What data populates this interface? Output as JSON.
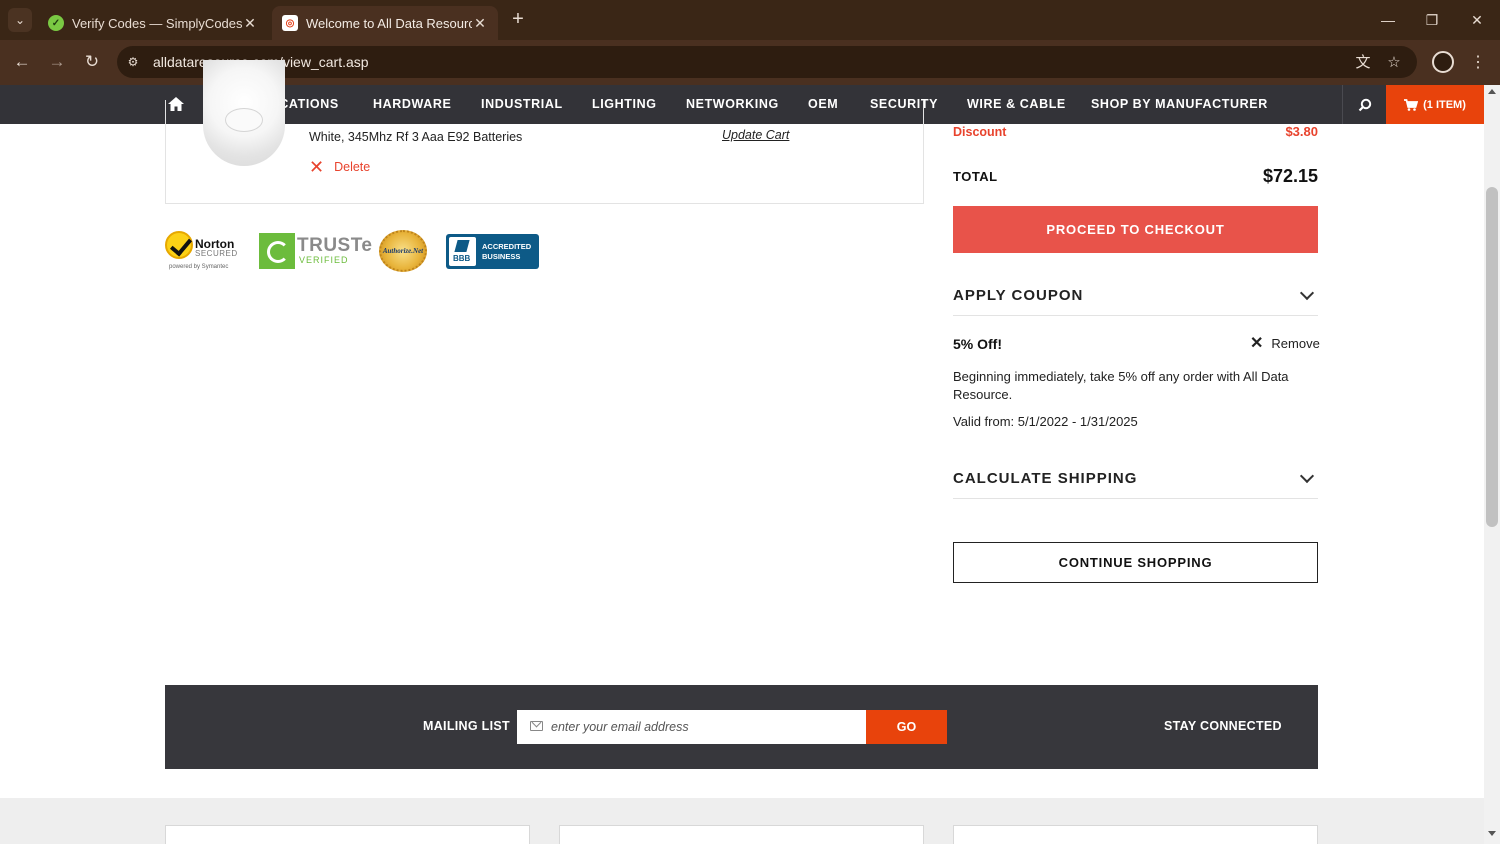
{
  "browser": {
    "tabs": [
      {
        "title": "Verify Codes — SimplyCodes",
        "active": false
      },
      {
        "title": "Welcome to All Data Resource",
        "active": true
      }
    ],
    "url": "alldataresource.com/view_cart.asp"
  },
  "nav": {
    "items": [
      "COMMUNICATIONS",
      "HARDWARE",
      "INDUSTRIAL",
      "LIGHTING",
      "NETWORKING",
      "OEM",
      "SECURITY",
      "WIRE & CABLE",
      "SHOP BY MANUFACTURER"
    ],
    "cart_label": "(1 ITEM)",
    "accent_color": "#e8430c",
    "bar_color": "#333338"
  },
  "cart_item": {
    "name": "White, 345Mhz Rf 3 Aaa E92 Batteries",
    "update_label": "Update Cart",
    "delete_label": "Delete"
  },
  "badges": {
    "norton": {
      "name": "Norton",
      "secured": "SECURED",
      "powered": "powered by Symantec"
    },
    "truste": {
      "name": "TRUSTe",
      "verified": "VERIFIED"
    },
    "authnet": {
      "name": "Authorize.Net"
    },
    "bbb": {
      "seal": "BBB",
      "line1": "ACCREDITED",
      "line2": "BUSINESS"
    }
  },
  "summary": {
    "discount_label": "Discount",
    "discount_value": "$3.80",
    "total_label": "TOTAL",
    "total_value": "$72.15",
    "checkout_label": "PROCEED TO CHECKOUT",
    "coupon_section": "APPLY COUPON",
    "coupon_name": "5% Off!",
    "remove_label": "Remove",
    "coupon_desc": "Beginning immediately, take 5% off any order with All Data Resource.",
    "coupon_valid": "Valid from: 5/1/2022 - 1/31/2025",
    "shipping_section": "CALCULATE SHIPPING",
    "continue_label": "CONTINUE SHOPPING"
  },
  "mailing": {
    "label": "MAILING LIST",
    "placeholder": "enter your email address",
    "go_label": "GO",
    "stay_label": "STAY CONNECTED"
  }
}
